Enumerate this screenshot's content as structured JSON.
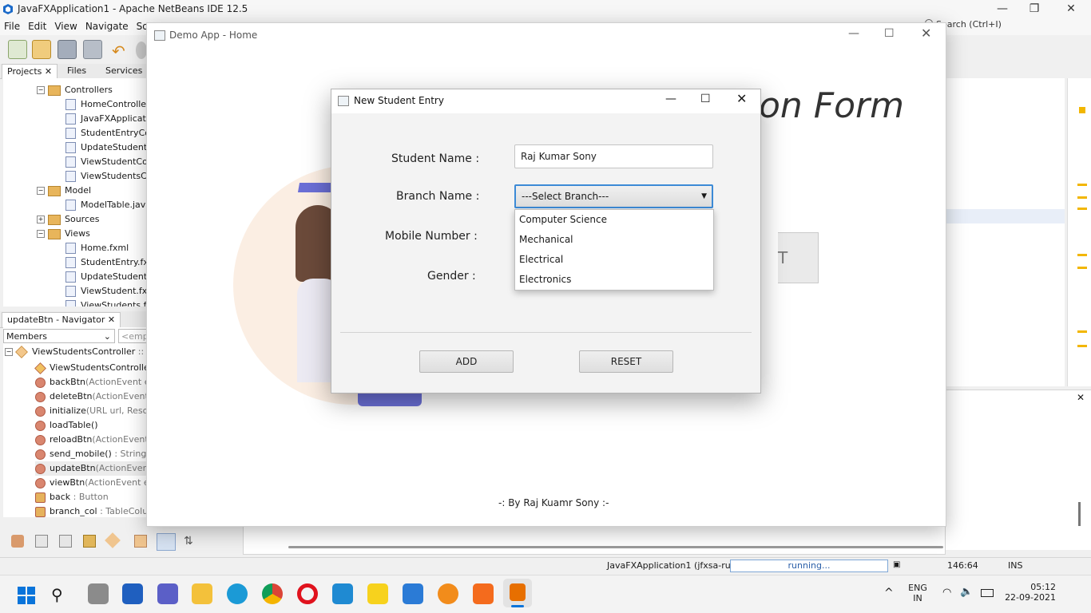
{
  "ide": {
    "window_title": "JavaFXApplication1 - Apache NetBeans IDE 12.5",
    "menu": [
      "File",
      "Edit",
      "View",
      "Navigate",
      "Sou"
    ],
    "search_placeholder": "Search (Ctrl+I)",
    "project_tabs": [
      "Projects",
      "Files",
      "Services"
    ],
    "tree": [
      {
        "label": "Controllers",
        "kind": "folder",
        "level": 1,
        "expander": "−"
      },
      {
        "label": "HomeController.j",
        "kind": "file",
        "level": 2
      },
      {
        "label": "JavaFXApplicati",
        "kind": "file",
        "level": 2
      },
      {
        "label": "StudentEntryCo",
        "kind": "file",
        "level": 2
      },
      {
        "label": "UpdateStudentC",
        "kind": "file",
        "level": 2
      },
      {
        "label": "ViewStudentCon",
        "kind": "file",
        "level": 2
      },
      {
        "label": "ViewStudentsCo",
        "kind": "file",
        "level": 2
      },
      {
        "label": "Model",
        "kind": "folder",
        "level": 1,
        "expander": "−"
      },
      {
        "label": "ModelTable.java",
        "kind": "file",
        "level": 2
      },
      {
        "label": "Sources",
        "kind": "folder",
        "level": 1,
        "expander": "+"
      },
      {
        "label": "Views",
        "kind": "folder",
        "level": 1,
        "expander": "−"
      },
      {
        "label": "Home.fxml",
        "kind": "file",
        "level": 2
      },
      {
        "label": "StudentEntry.fx",
        "kind": "file",
        "level": 2
      },
      {
        "label": "UpdateStudent.",
        "kind": "file",
        "level": 2
      },
      {
        "label": "ViewStudent.fxm",
        "kind": "file",
        "level": 2
      },
      {
        "label": "ViewStudents.fx",
        "kind": "file",
        "level": 2
      }
    ],
    "navigator_title": "updateBtn - Navigator",
    "navigator_filter": "Members",
    "navigator_empty": "<empt",
    "navigator_root": {
      "name": "ViewStudentsController",
      "suffix": " :: In"
    },
    "members": [
      {
        "name": "ViewStudentsController(",
        "type": ""
      },
      {
        "name": "backBtn",
        "type": "(ActionEvent ev"
      },
      {
        "name": "deleteBtn",
        "type": "(ActionEvent e"
      },
      {
        "name": "initialize",
        "type": "(URL url, Resour"
      },
      {
        "name": "loadTable()",
        "type": ""
      },
      {
        "name": "reloadBtn",
        "type": "(ActionEvent e"
      },
      {
        "name": "send_mobile()",
        "type": " : String"
      },
      {
        "name": "updateBtn",
        "type": "(ActionEvent e"
      },
      {
        "name": "viewBtn",
        "type": "(ActionEvent ev"
      },
      {
        "name": "back",
        "type": " : Button"
      },
      {
        "name": "branch_col",
        "type": " : TableColum"
      }
    ],
    "status": {
      "run_label": "JavaFXApplication1 (jfxsa-run)",
      "progress_text": "running...",
      "position": "146:64",
      "mode": "INS"
    }
  },
  "demo_app": {
    "title": "Demo App - Home",
    "heading_visible": "on Form",
    "button_fragment": "T",
    "credit": "-: By Raj Kuamr Sony :-"
  },
  "dialog": {
    "title": "New Student Entry",
    "fields": {
      "name_label": "Student Name :",
      "name_value": "Raj Kumar Sony",
      "branch_label": "Branch Name :",
      "branch_value": "---Select Branch---",
      "mobile_label": "Mobile Number :",
      "gender_label": "Gender :"
    },
    "branch_options": [
      "Computer Science",
      "Mechanical",
      "Electrical",
      "Electronics"
    ],
    "add_label": "ADD",
    "reset_label": "RESET"
  },
  "taskbar": {
    "lang": "ENG",
    "region": "IN",
    "time": "05:12",
    "date": "22-09-2021",
    "apps": [
      "start",
      "search",
      "task-view",
      "widgets",
      "teams",
      "file-explorer",
      "edge",
      "chrome",
      "opera",
      "vscode",
      "sticky-notes",
      "virtualbox",
      "blender",
      "xampp",
      "java"
    ]
  },
  "colors": {
    "accent": "#3c8ad6",
    "taskbar_bg": "#f3f3f3",
    "dialog_bg": "#f3f3f3"
  }
}
